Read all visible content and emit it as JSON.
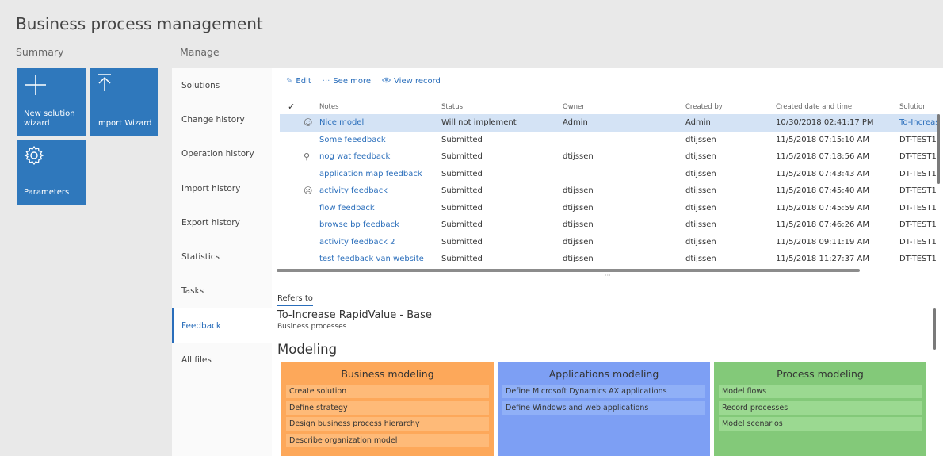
{
  "app": {
    "title": "Business process management"
  },
  "summary": {
    "label": "Summary",
    "tiles": [
      {
        "label": "New solution wizard",
        "icon": "plus-icon"
      },
      {
        "label": "Import Wizard",
        "icon": "upload-arrow-icon"
      },
      {
        "label": "Parameters",
        "icon": "gear-icon"
      }
    ]
  },
  "manage": {
    "label": "Manage",
    "nav": [
      {
        "label": "Solutions"
      },
      {
        "label": "Change history"
      },
      {
        "label": "Operation history"
      },
      {
        "label": "Import history"
      },
      {
        "label": "Export history"
      },
      {
        "label": "Statistics"
      },
      {
        "label": "Tasks"
      },
      {
        "label": "Feedback",
        "active": true
      },
      {
        "label": "All files"
      }
    ]
  },
  "toolbar": {
    "edit": "Edit",
    "see_more": "See more",
    "view_record": "View record",
    "more_glyph": "···"
  },
  "grid": {
    "columns": {
      "check": "✓",
      "notes": "Notes",
      "status": "Status",
      "owner": "Owner",
      "created_by": "Created by",
      "created_date": "Created date and time",
      "solution": "Solution"
    },
    "rows": [
      {
        "icon": "☺",
        "notes": "Nice model",
        "status": "Will not implement",
        "owner": "Admin",
        "created_by": "Admin",
        "created_date": "10/30/2018 02:41:17 PM",
        "solution": "To-Increase",
        "selected": true
      },
      {
        "icon": "",
        "notes": "Some feeedback",
        "status": "Submitted",
        "owner": "",
        "created_by": "dtijssen",
        "created_date": "11/5/2018 07:15:10 AM",
        "solution": "DT-TEST1"
      },
      {
        "icon": "♀",
        "notes": "nog wat feedback",
        "status": "Submitted",
        "owner": "dtijssen",
        "created_by": "dtijssen",
        "created_date": "11/5/2018 07:18:56 AM",
        "solution": "DT-TEST1"
      },
      {
        "icon": "",
        "notes": "application map feedback",
        "status": "Submitted",
        "owner": "",
        "created_by": "dtijssen",
        "created_date": "11/5/2018 07:43:43 AM",
        "solution": "DT-TEST1"
      },
      {
        "icon": "☹",
        "notes": "activity feedback",
        "status": "Submitted",
        "owner": "dtijssen",
        "created_by": "dtijssen",
        "created_date": "11/5/2018 07:45:40 AM",
        "solution": "DT-TEST1"
      },
      {
        "icon": "",
        "notes": "flow feedback",
        "status": "Submitted",
        "owner": "dtijssen",
        "created_by": "dtijssen",
        "created_date": "11/5/2018 07:45:59 AM",
        "solution": "DT-TEST1"
      },
      {
        "icon": "",
        "notes": "browse bp feedback",
        "status": "Submitted",
        "owner": "dtijssen",
        "created_by": "dtijssen",
        "created_date": "11/5/2018 07:46:26 AM",
        "solution": "DT-TEST1"
      },
      {
        "icon": "",
        "notes": "activity feedback 2",
        "status": "Submitted",
        "owner": "dtijssen",
        "created_by": "dtijssen",
        "created_date": "11/5/2018 09:11:19 AM",
        "solution": "DT-TEST1"
      },
      {
        "icon": "",
        "notes": "test feedback van website",
        "status": "Submitted",
        "owner": "dtijssen",
        "created_by": "dtijssen",
        "created_date": "11/5/2018 11:27:37 AM",
        "solution": "DT-TEST1"
      }
    ],
    "scroll_dots": "···"
  },
  "refers": {
    "tab": "Refers to",
    "title": "To-Increase RapidValue - Base",
    "subtitle": "Business processes"
  },
  "modeling": {
    "title": "Modeling",
    "panels": [
      {
        "title": "Business modeling",
        "color": "#fda85a",
        "items": [
          "Create solution",
          "Define strategy",
          "Design business process hierarchy",
          "Describe organization model"
        ]
      },
      {
        "title": "Applications modeling",
        "color": "#7d9ff4",
        "items": [
          "Define Microsoft Dynamics AX applications",
          "Define Windows and web applications"
        ]
      },
      {
        "title": "Process modeling",
        "color": "#83c979",
        "items": [
          "Model flows",
          "Record processes",
          "Model scenarios"
        ]
      }
    ]
  }
}
